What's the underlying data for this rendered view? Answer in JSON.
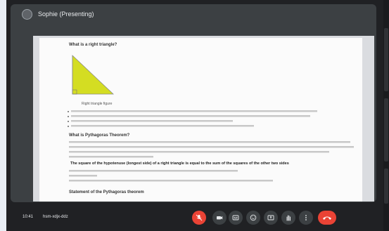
{
  "colors": {
    "end_call": "#ea4335",
    "triangle_fill": "#d4dd22"
  },
  "presenter": {
    "name": "Sophie (Presenting)"
  },
  "doc": {
    "heading1": "What is a right triangle?",
    "figure_caption": "Right triangle figure",
    "heading2": "What is Pythagoras Theorem?",
    "key_line": "The square of the hypotenuse (longest side) of a right triangle is equal to the sum of the squares of the other two sides",
    "heading3": "Statement of the Pythagoras theorem"
  },
  "bottom_bar": {
    "time": "10:41",
    "meeting_code": "hsm-xdjx-ddz"
  },
  "controls": [
    {
      "name": "mic-off-icon",
      "label": "Turn on microphone"
    },
    {
      "name": "camera-icon",
      "label": "Turn off camera"
    },
    {
      "name": "captions-icon",
      "label": "Turn on captions"
    },
    {
      "name": "emoji-icon",
      "label": "Send a reaction"
    },
    {
      "name": "present-icon",
      "label": "Present now"
    },
    {
      "name": "raise-hand-icon",
      "label": "Raise hand"
    },
    {
      "name": "more-options-icon",
      "label": "More options"
    },
    {
      "name": "end-call-icon",
      "label": "Leave call"
    }
  ]
}
